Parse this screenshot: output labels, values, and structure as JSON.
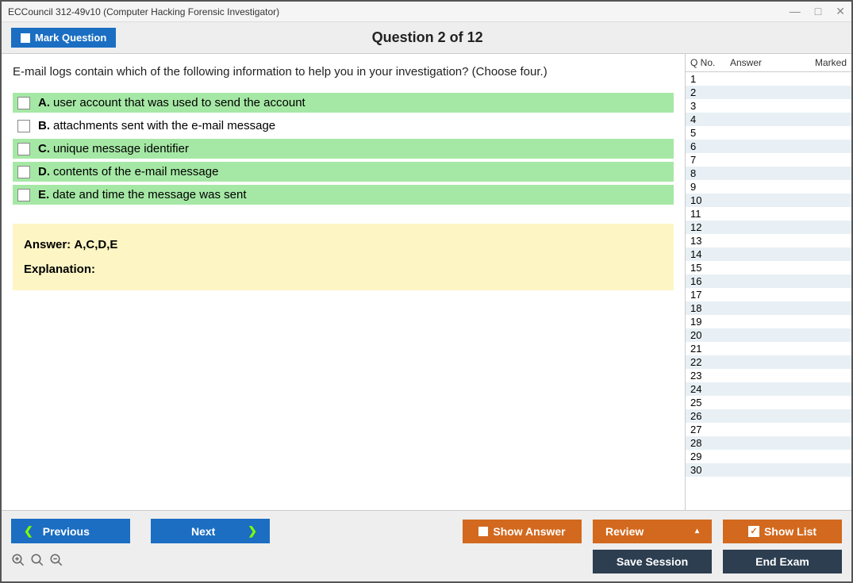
{
  "window": {
    "title": "ECCouncil 312-49v10 (Computer Hacking Forensic Investigator)"
  },
  "header": {
    "mark_label": "Mark Question",
    "question_title": "Question 2 of 12"
  },
  "question": {
    "text": "E-mail logs contain which of the following information to help you in your investigation? (Choose four.)",
    "options": [
      {
        "letter": "A.",
        "text": "user account that was used to send the account",
        "correct": true
      },
      {
        "letter": "B.",
        "text": "attachments sent with the e-mail message",
        "correct": false
      },
      {
        "letter": "C.",
        "text": "unique message identifier",
        "correct": true
      },
      {
        "letter": "D.",
        "text": "contents of the e-mail message",
        "correct": true
      },
      {
        "letter": "E.",
        "text": "date and time the message was sent",
        "correct": true
      }
    ],
    "answer_label": "Answer:",
    "answer_text": "A,C,D,E",
    "explanation_label": "Explanation:"
  },
  "sidebar": {
    "col_qno": "Q No.",
    "col_answer": "Answer",
    "col_marked": "Marked",
    "rows": [
      "1",
      "2",
      "3",
      "4",
      "5",
      "6",
      "7",
      "8",
      "9",
      "10",
      "11",
      "12",
      "13",
      "14",
      "15",
      "16",
      "17",
      "18",
      "19",
      "20",
      "21",
      "22",
      "23",
      "24",
      "25",
      "26",
      "27",
      "28",
      "29",
      "30"
    ]
  },
  "buttons": {
    "previous": "Previous",
    "next": "Next",
    "show_answer": "Show Answer",
    "review": "Review",
    "show_list": "Show List",
    "save_session": "Save Session",
    "end_exam": "End Exam"
  }
}
